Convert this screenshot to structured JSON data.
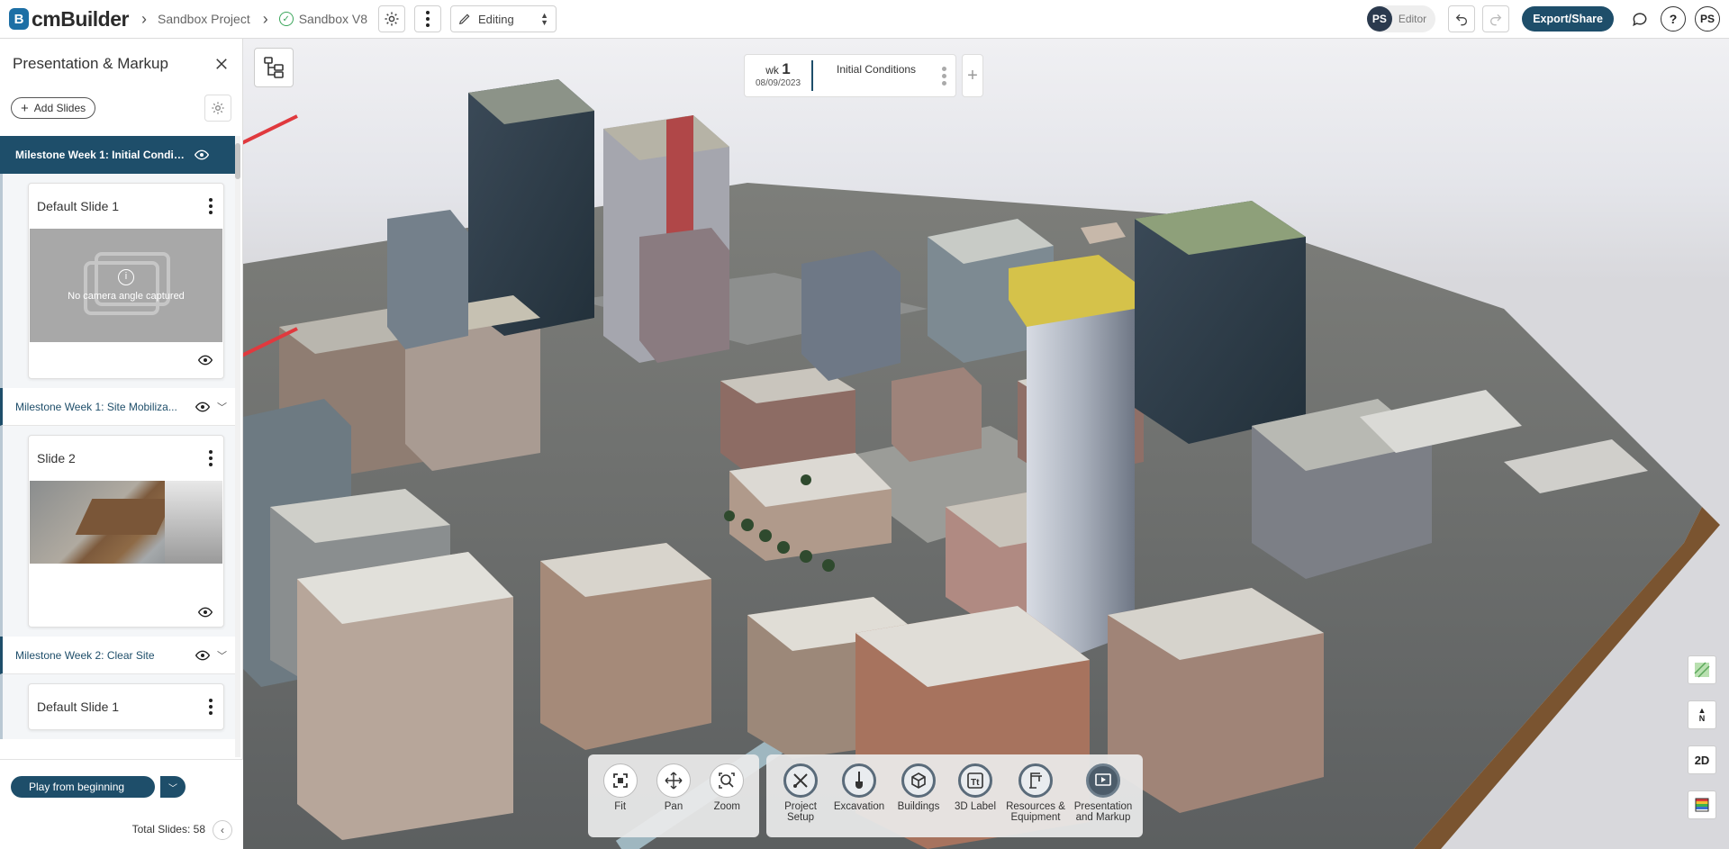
{
  "app": {
    "logo_letter": "B",
    "logo_text": "cmBuilder"
  },
  "header": {
    "breadcrumb_project": "Sandbox Project",
    "breadcrumb_version": "Sandbox V8",
    "mode": "Editing",
    "user_initials": "PS",
    "role": "Editor",
    "export_label": "Export/Share",
    "help": "?",
    "profile_initials": "PS"
  },
  "panel": {
    "title": "Presentation & Markup",
    "add_slides": "Add Slides",
    "milestones": [
      {
        "label": "Milestone Week 1: Initial Conditi...",
        "state": "active"
      },
      {
        "label": "Milestone Week 1: Site Mobiliza...",
        "state": "inactive"
      },
      {
        "label": "Milestone Week 2: Clear Site",
        "state": "inactive"
      }
    ],
    "slides": [
      {
        "title": "Default Slide 1",
        "placeholder": "No camera angle captured"
      },
      {
        "title": "Slide 2"
      },
      {
        "title": "Default Slide 1"
      }
    ],
    "play_label": "Play from beginning",
    "total_slides": "Total Slides: 58"
  },
  "timeline": {
    "week_prefix": "wk",
    "week_number": "1",
    "date": "08/09/2023",
    "phase": "Initial Conditions"
  },
  "tools": {
    "nav": [
      {
        "label": "Fit",
        "icon": "fit-icon"
      },
      {
        "label": "Pan",
        "icon": "pan-icon"
      },
      {
        "label": "Zoom",
        "icon": "zoom-icon"
      }
    ],
    "main": [
      {
        "line1": "Project",
        "line2": "Setup",
        "icon": "tools-icon"
      },
      {
        "line1": "Excavation",
        "line2": "",
        "icon": "shovel-icon"
      },
      {
        "line1": "Buildings",
        "line2": "",
        "icon": "buildings-icon"
      },
      {
        "line1": "3D Label",
        "line2": "",
        "icon": "text-label-icon"
      },
      {
        "line1": "Resources &",
        "line2": "Equipment",
        "icon": "crane-icon"
      },
      {
        "line1": "Presentation",
        "line2": "and Markup",
        "icon": "presentation-icon"
      }
    ]
  },
  "side_tools": {
    "north_label": "N",
    "view_2d": "2D"
  }
}
